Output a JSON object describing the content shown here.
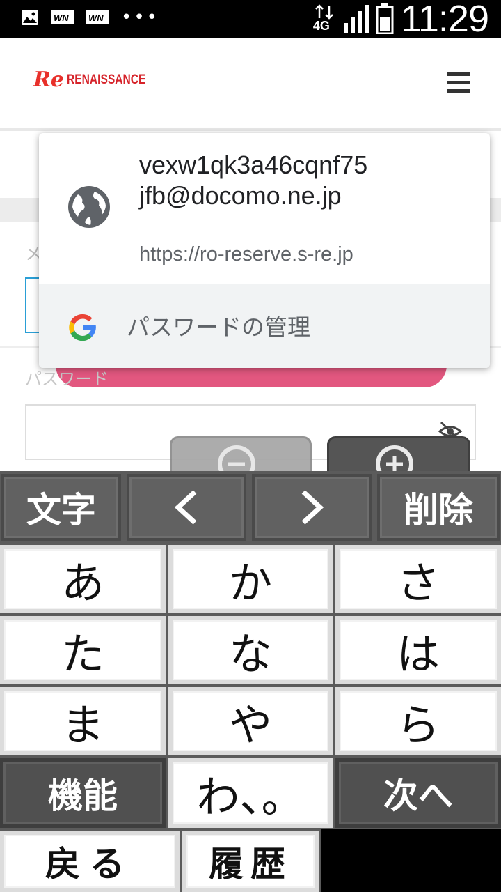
{
  "status_bar": {
    "network": "4G",
    "time": "11:29",
    "dots": "•••",
    "notification_icons": [
      "image-icon",
      "wn-icon",
      "wn-icon"
    ]
  },
  "header": {
    "logo_mark": "Re",
    "logo_text": "RENAISSANCE",
    "menu_icon": "hamburger-menu-icon"
  },
  "form": {
    "mail_label": "メ",
    "password_label": "パスワード"
  },
  "autofill": {
    "email": "vexw1qk3a46cqnf75jfb@docomo.ne.jp",
    "url": "https://ro-reserve.s-re.jp",
    "manage_passwords": "パスワードの管理"
  },
  "zoom": {
    "zoom_out_icon": "zoom-out-icon",
    "zoom_in_icon": "zoom-in-icon"
  },
  "keyboard": {
    "top_row": [
      "文字",
      "＜",
      "＞",
      "削除"
    ],
    "rows": [
      [
        "あ",
        "か",
        "さ"
      ],
      [
        "た",
        "な",
        "は"
      ],
      [
        "ま",
        "や",
        "ら"
      ]
    ],
    "function_key": "機能",
    "wa_key": "わ、。",
    "next_key": "次へ",
    "back_key": "戻る",
    "history_key": "履歴"
  }
}
